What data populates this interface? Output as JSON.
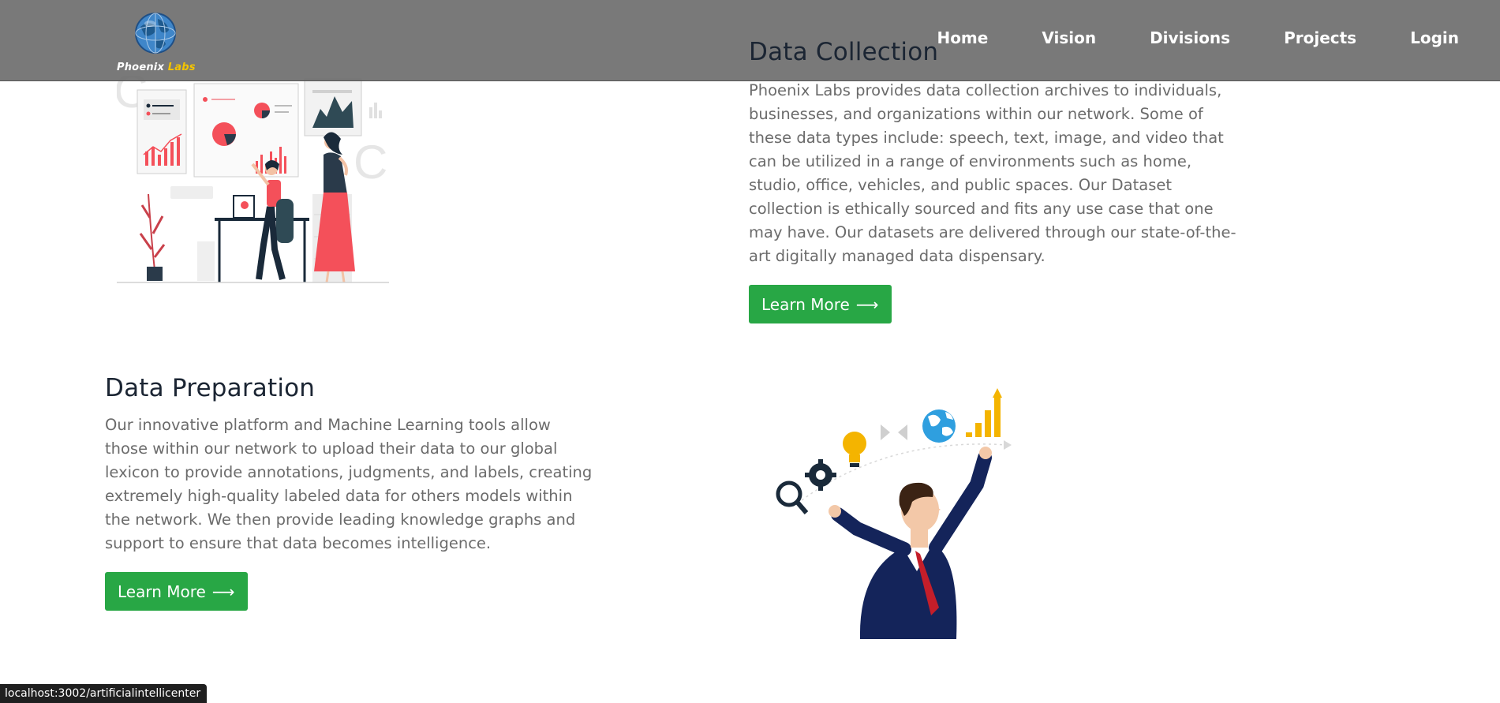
{
  "brand": {
    "name_part1": "Phoenix",
    "name_part2": "Labs",
    "logo_icon": "globe-icon"
  },
  "nav": {
    "items": [
      "Home",
      "Vision",
      "Divisions",
      "Projects",
      "Login"
    ]
  },
  "section1": {
    "title": "Data Collection",
    "body": "Phoenix Labs provides data collection archives to individuals, businesses, and organizations within our network. Some of these data types include: speech, text, image, and video that can be utilized in a range of environments such as home, studio, office, vehicles, and public spaces. Our Dataset collection is ethically sourced and fits any use case that one may have. Our datasets are delivered through our state-of-the-art digitally managed data dispensary.",
    "button_label": "Learn More",
    "button_arrow": "⟶"
  },
  "section2": {
    "title": "Data Preparation",
    "body": "Our innovative platform and Machine Learning tools allow those within our network to upload their data to our global lexicon to provide annotations, judgments, and labels, creating extremely high-quality labeled data for others models within the network. We then provide leading knowledge graphs and support to ensure that data becomes intelligence.",
    "button_label": "Learn More",
    "button_arrow": "⟶"
  },
  "status_bar": {
    "url": "localhost:3002/artificialintellicenter"
  },
  "colors": {
    "header_bg": "#6e6e6e",
    "button_green": "#28a745",
    "brand_yellow": "#f4c400",
    "accent_red": "#f4505a",
    "navy": "#1a2a5c"
  }
}
